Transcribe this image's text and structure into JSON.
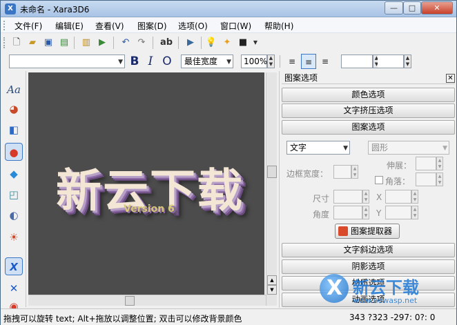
{
  "window": {
    "title": "未命名 - Xara3D6",
    "app_icon": "X",
    "minimize": "—",
    "maximize": "□",
    "close": "✕"
  },
  "menu": [
    "文件(F)",
    "编辑(E)",
    "查看(V)",
    "图案(D)",
    "选项(O)",
    "窗口(W)",
    "帮助(H)"
  ],
  "toolbar1": {
    "icons": [
      "new-file-icon",
      "open-folder-icon",
      "save-icon",
      "save-image-icon",
      "properties-icon",
      "edit-text-icon",
      "undo-icon",
      "redo-icon",
      "spellcheck-icon",
      "play-animation-icon",
      "light-bulb-icon",
      "magic-wand-icon",
      "export-icon"
    ],
    "spellcheck_label": "ab"
  },
  "toolbar2": {
    "font_value": "",
    "bold": "B",
    "italic": "I",
    "outline": "O",
    "width_value": "最佳宽度",
    "zoom_value": "100%",
    "align_left": "≡",
    "align_center": "≡",
    "align_right": "≡",
    "field_a": "",
    "field_b": ""
  },
  "tools": [
    {
      "name": "text-tool-icon",
      "glyph": "Aa"
    },
    {
      "name": "color-palette-icon",
      "glyph": "◕"
    },
    {
      "name": "extrude-icon",
      "glyph": "◧"
    },
    {
      "name": "pattern-icon",
      "glyph": "●"
    },
    {
      "name": "bevel-icon",
      "glyph": "◆"
    },
    {
      "name": "shapes-icon",
      "glyph": "◰"
    },
    {
      "name": "texture-icon",
      "glyph": "◐"
    },
    {
      "name": "lighting-icon",
      "glyph": "☀"
    },
    {
      "name": "xara-logo-icon",
      "glyph": "X"
    },
    {
      "name": "xara-logo-alt-icon",
      "glyph": "✕"
    },
    {
      "name": "animation-icon",
      "glyph": "◉"
    }
  ],
  "canvas": {
    "text": "新云下载",
    "version": "Version 6"
  },
  "panel": {
    "title": "图案选项",
    "close": "✕",
    "sections_top": [
      "颜色选项",
      "文字挤压选项",
      "图案选项"
    ],
    "pattern_type": "文字",
    "pattern_shape": "圆形",
    "border_width_label": "边框宽度：",
    "stretch_label": "伸展：",
    "corner_label": "角落：",
    "size_label": "尺寸",
    "x_label": "X",
    "angle_label": "角度",
    "y_label": "Y",
    "fetch_button": "图案提取器",
    "sections_bottom": [
      "文字斜边选项",
      "阴影选项",
      "材质选项",
      "动画选项"
    ]
  },
  "status": {
    "message": "拖拽可以旋转 text; Alt+拖放以调整位置; 双击可以修改背景颜色",
    "coords": "343 ?323  -297: 0?: 0"
  },
  "watermark": {
    "logo": "X",
    "title": "新云下载",
    "url": "www.newasp.net"
  }
}
